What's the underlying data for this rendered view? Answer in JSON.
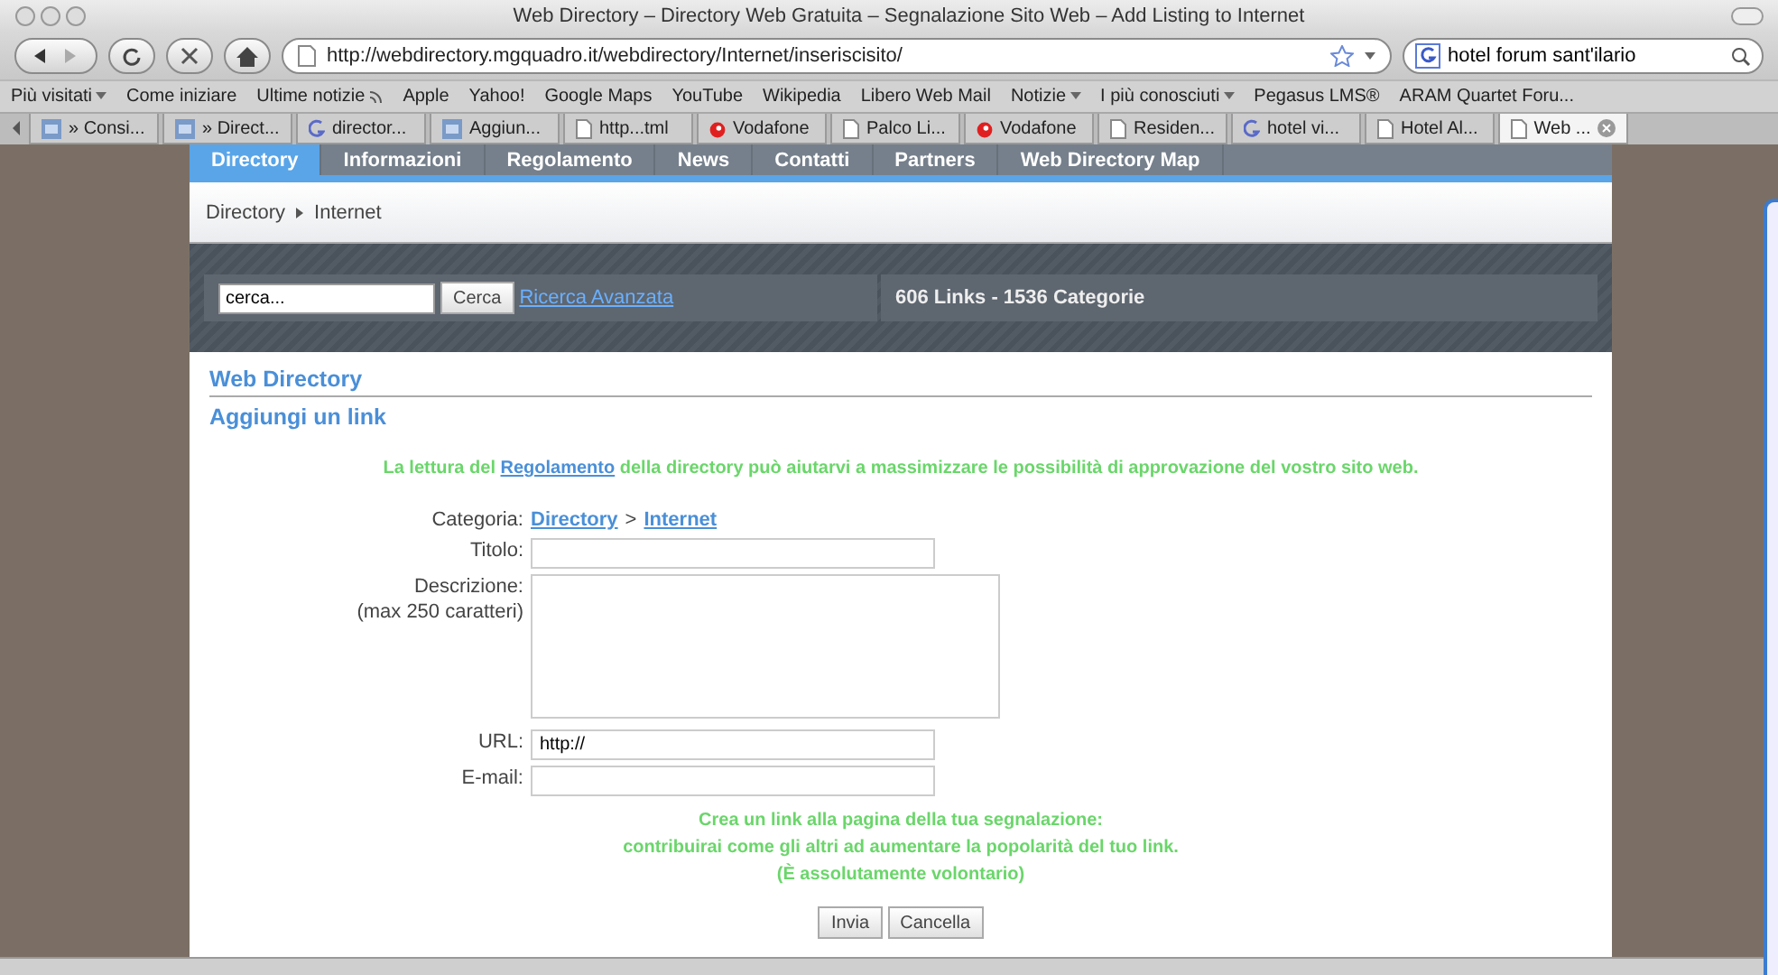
{
  "window": {
    "title": "Web Directory – Directory Web Gratuita – Segnalazione Sito Web – Add Listing to Internet"
  },
  "address": {
    "url": "http://webdirectory.mgquadro.it/webdirectory/Internet/inseriscisito/"
  },
  "search": {
    "value": "hotel forum sant'ilario"
  },
  "bookmarks": [
    {
      "label": "Più visitati",
      "kind": "menu"
    },
    {
      "label": "Come iniziare",
      "kind": "link"
    },
    {
      "label": "Ultime notizie",
      "kind": "feed"
    },
    {
      "label": "Apple",
      "kind": "link"
    },
    {
      "label": "Yahoo!",
      "kind": "link"
    },
    {
      "label": "Google Maps",
      "kind": "link"
    },
    {
      "label": "YouTube",
      "kind": "link"
    },
    {
      "label": "Wikipedia",
      "kind": "link"
    },
    {
      "label": "Libero Web Mail",
      "kind": "link"
    },
    {
      "label": "Notizie",
      "kind": "menu"
    },
    {
      "label": "I più conosciuti",
      "kind": "menu"
    },
    {
      "label": "Pegasus LMS®",
      "kind": "link"
    },
    {
      "label": "ARAM Quartet Foru...",
      "kind": "link"
    }
  ],
  "browser_tabs": [
    {
      "label": "» Consi...",
      "kind": "gt",
      "selected": false
    },
    {
      "label": "» Direct...",
      "kind": "gt",
      "selected": false
    },
    {
      "label": "director...",
      "kind": "google",
      "selected": false
    },
    {
      "label": "Aggiun...",
      "kind": "gt",
      "selected": false
    },
    {
      "label": "http...tml",
      "kind": "doc",
      "selected": false
    },
    {
      "label": "Vodafone",
      "kind": "drop",
      "selected": false
    },
    {
      "label": "Palco Li...",
      "kind": "doc",
      "selected": false
    },
    {
      "label": "Vodafone",
      "kind": "drop",
      "selected": false
    },
    {
      "label": "Residen...",
      "kind": "doc",
      "selected": false
    },
    {
      "label": "hotel vi...",
      "kind": "google",
      "selected": false
    },
    {
      "label": "Hotel Al...",
      "kind": "doc",
      "selected": false
    },
    {
      "label": "Web ...",
      "kind": "doc",
      "selected": true
    }
  ],
  "site_nav": [
    {
      "label": "Directory",
      "selected": true
    },
    {
      "label": "Informazioni",
      "selected": false
    },
    {
      "label": "Regolamento",
      "selected": false
    },
    {
      "label": "News",
      "selected": false
    },
    {
      "label": "Contatti",
      "selected": false
    },
    {
      "label": "Partners",
      "selected": false
    },
    {
      "label": "Web Directory Map",
      "selected": false
    }
  ],
  "breadcrumb": [
    "Directory",
    "Internet"
  ],
  "site_search": {
    "value": "cerca...",
    "button": "Cerca",
    "advanced": "Ricerca Avanzata",
    "stats": "606 Links - 1536 Categorie"
  },
  "section_title": "Web Directory",
  "form_title": "Aggiungi un link",
  "notice": {
    "before": "La lettura del",
    "link": "Regolamento",
    "after": "della directory può aiutarvi a massimizzare le possibilità di approvazione del vostro sito web."
  },
  "category": {
    "label": "Categoria:",
    "path": [
      "Directory",
      "Internet"
    ],
    "separator": ">"
  },
  "fields": [
    {
      "label": "Titolo:",
      "kind": "input"
    },
    {
      "label": "Descrizione:",
      "hint": "(max 250 caratteri)",
      "kind": "textarea"
    },
    {
      "label": "URL:",
      "kind": "input",
      "value": "http://"
    },
    {
      "label": "E-mail:",
      "kind": "input"
    }
  ],
  "promo": [
    "Crea un link alla pagina della tua segnalazione:",
    "contribuirai come gli altri ad aumentare la popolarità del tuo link.",
    "(È assolutamente volontario)"
  ],
  "buttons": [
    "Invia",
    "Cancella"
  ]
}
